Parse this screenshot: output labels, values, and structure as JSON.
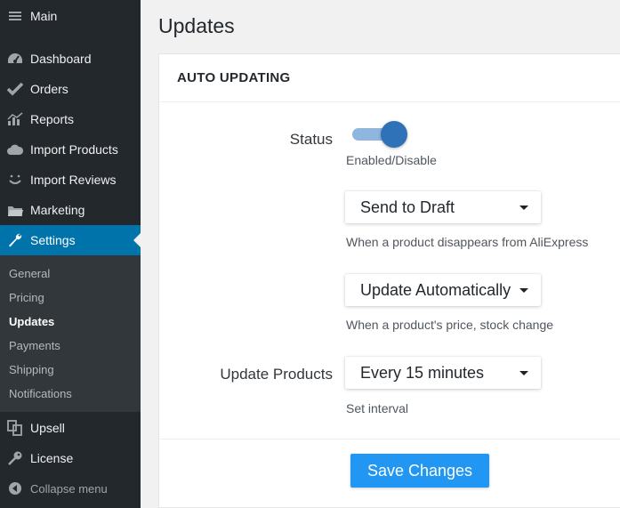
{
  "sidebar": {
    "main_label": "Main",
    "items": [
      {
        "label": "Dashboard",
        "icon": "dashboard-icon"
      },
      {
        "label": "Orders",
        "icon": "checkmark-icon"
      },
      {
        "label": "Reports",
        "icon": "chart-icon"
      },
      {
        "label": "Import Products",
        "icon": "cloud-icon"
      },
      {
        "label": "Import Reviews",
        "icon": "smile-icon"
      },
      {
        "label": "Marketing",
        "icon": "folder-icon"
      },
      {
        "label": "Settings",
        "icon": "wrench-icon",
        "active": true
      }
    ],
    "submenu": [
      "General",
      "Pricing",
      "Updates",
      "Payments",
      "Shipping",
      "Notifications"
    ],
    "submenu_current": "Updates",
    "bottom_items": [
      {
        "label": "Upsell",
        "icon": "upsell-icon"
      },
      {
        "label": "License",
        "icon": "key-icon"
      }
    ],
    "collapse_label": "Collapse menu"
  },
  "page": {
    "title": "Updates"
  },
  "panel": {
    "title": "AUTO UPDATING",
    "status_label": "Status",
    "status_enabled": true,
    "status_help": "Enabled/Disable",
    "disappear_select": "Send to Draft",
    "disappear_help": "When a product disappears from AliExpress",
    "price_select": "Update Automatically",
    "price_help": "When a product's price, stock change",
    "update_products_label": "Update Products",
    "interval_select": "Every 15 minutes",
    "interval_help": "Set interval",
    "save_label": "Save Changes"
  },
  "colors": {
    "sidebar_bg": "#23282d",
    "active_bg": "#0073aa",
    "toggle_knob": "#2f72b7",
    "save_button": "#2196f3"
  }
}
